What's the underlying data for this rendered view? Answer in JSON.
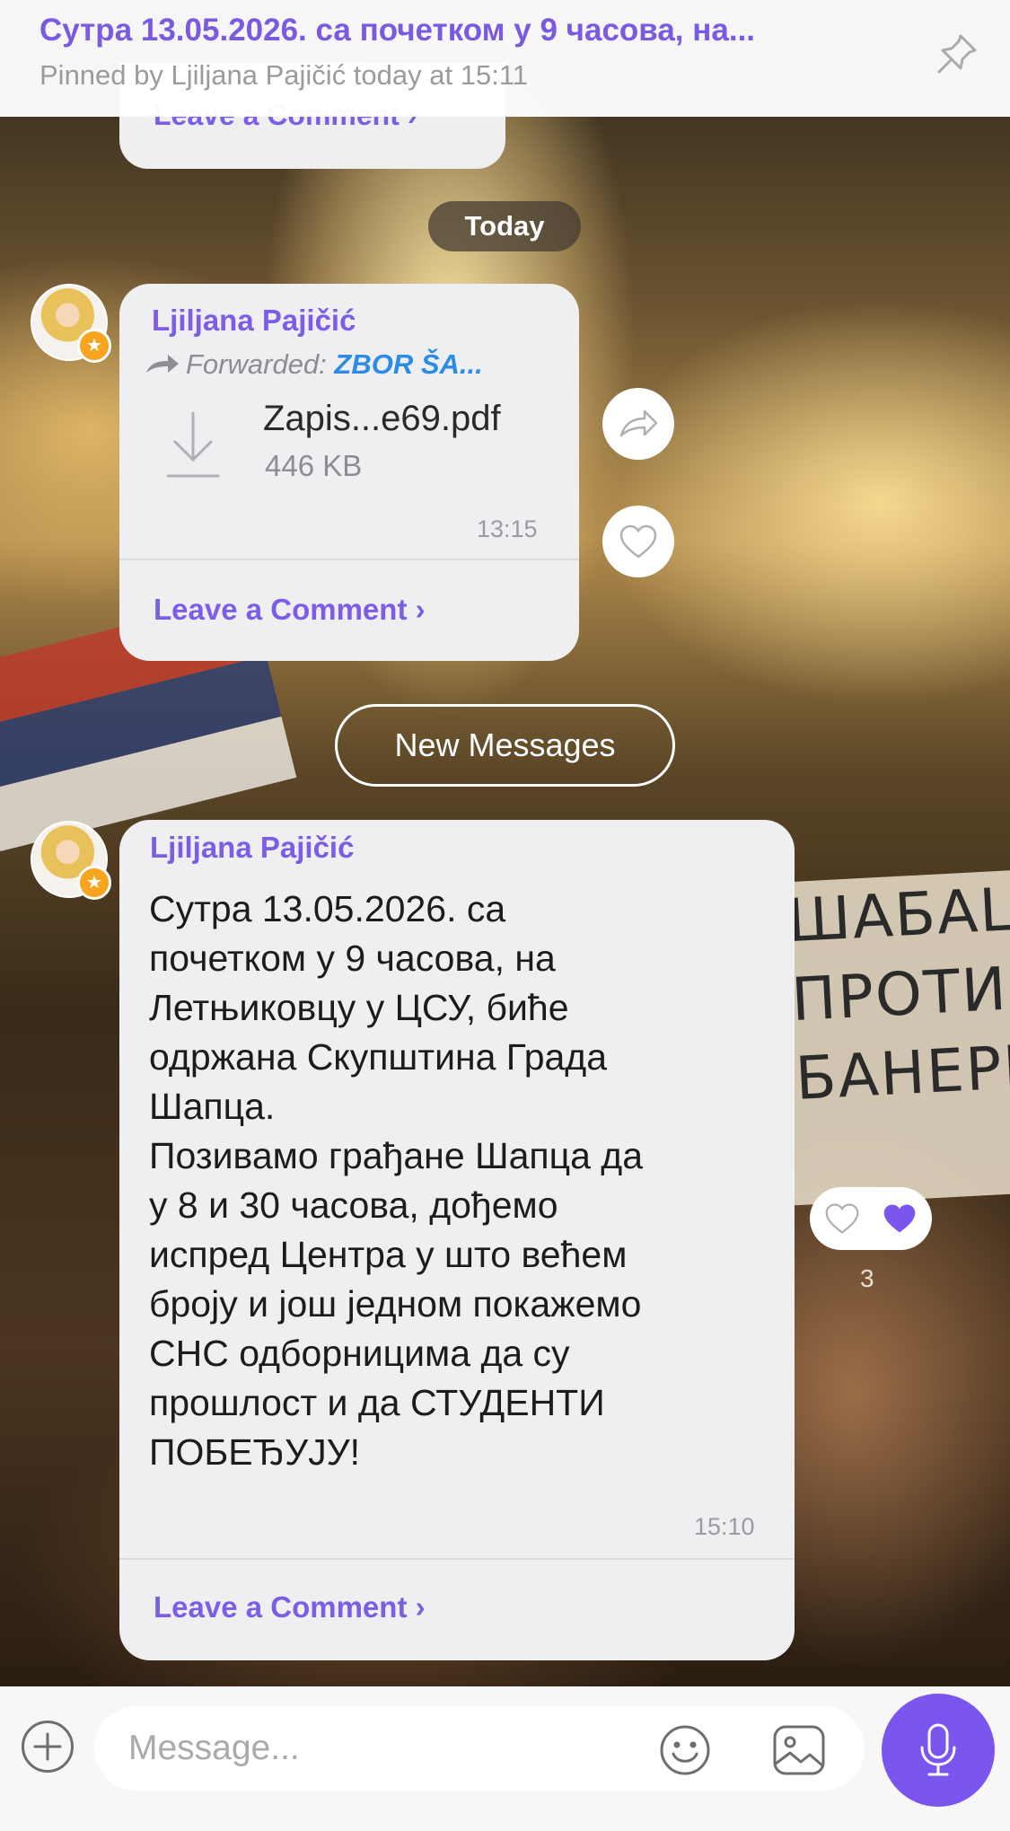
{
  "pinned": {
    "title": "Сутра 13.05.2026. са почетком у 9 часова, на...",
    "subtitle": "Pinned by Ljiljana Pajičić today at 15:11"
  },
  "previous_message": {
    "comment_label": "Leave a Comment ›"
  },
  "date_separator": "Today",
  "file_message": {
    "sender": "Ljiljana Pajičić",
    "forwarded_label": "Forwarded:",
    "forwarded_from": "ZBOR ŠA...",
    "file_name": "Zapis...e69.pdf",
    "file_size": "446 KB",
    "time": "13:15",
    "comment_label": "Leave a Comment ›"
  },
  "new_messages_label": "New Messages",
  "text_message": {
    "sender": "Ljiljana Pajičić",
    "body": "Сутра 13.05.2026. са\nпочетком у 9 часова, на\nЛетњиковцу у ЦСУ, биће\nодржана Скупштина Града\nШапца.\nПозивамо грађане Шапца да\nу 8 и 30 часова, дођемо\nиспред Центра у што већем\nброју и још једном покажемо\nСНС одборницима да су\nпрошлост и да СТУДЕНТИ\nПОБЕЂУЈУ!",
    "time": "15:10",
    "reactions_count": "3",
    "comment_label": "Leave a Comment ›"
  },
  "input": {
    "placeholder": "Message..."
  },
  "background_banner": [
    "ШАБАЦ",
    "ПРОТИВ",
    "БАНЕРИ"
  ],
  "colors": {
    "accent": "#7c5ee6",
    "link_blue": "#2c8be3",
    "mic_button": "#7a55ee",
    "star_badge": "#f7a41e"
  },
  "icons": {
    "pin": "pin-icon",
    "share": "share-icon",
    "like": "heart-icon",
    "download": "download-icon",
    "plus": "plus-icon",
    "emoji": "emoji-icon",
    "sticker": "sticker-icon",
    "mic": "mic-icon"
  }
}
